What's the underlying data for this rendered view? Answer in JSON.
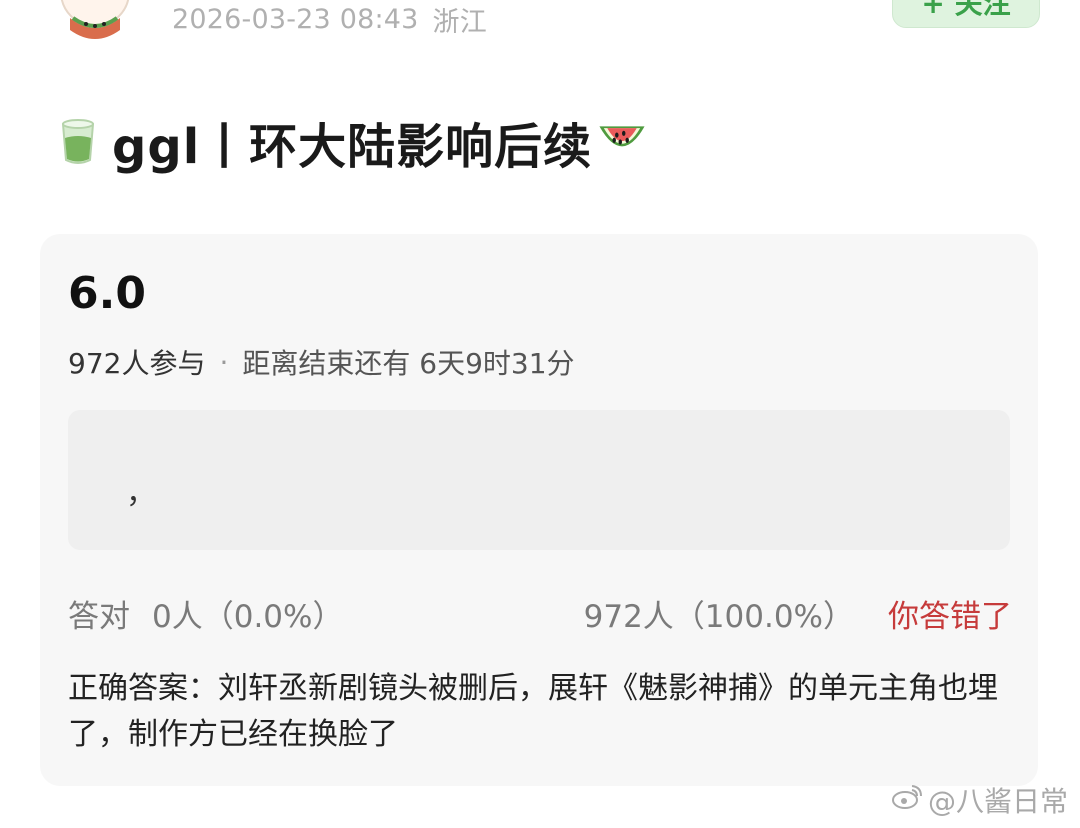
{
  "header": {
    "timestamp": "2026-03-23 08:43",
    "location": "浙江",
    "follow_label": "+ 关注",
    "follow_color": "#3aa14a"
  },
  "post": {
    "title_prefix_icon": "tea-cup-icon",
    "title": "ggl丨环大陆影响后续",
    "title_suffix_icon": "watermelon-icon"
  },
  "quiz": {
    "score": "6.0",
    "participants": "972人参与",
    "separator": "·",
    "ends_in": "距离结束还有 6天9时31分",
    "option_text": "，",
    "correct_label": "答对",
    "correct_count": "0人（0.0%）",
    "wrong_count": "972人（100.0%）",
    "result_text": "你答错了",
    "result_color": "#c63b3b",
    "answer": "正确答案：刘轩丞新剧镜头被删后，展轩《魅影神捕》的单元主角也埋了，制作方已经在换脸了"
  },
  "watermark": {
    "icon": "weibo-logo-icon",
    "text": "@八酱日常"
  }
}
